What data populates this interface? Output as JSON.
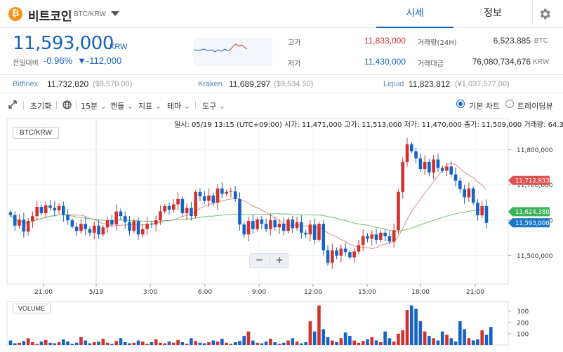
{
  "header": {
    "coin_symbol": "₿",
    "coin_name": "비트코인",
    "pair": "BTC/KRW",
    "tabs": [
      {
        "label": "시세",
        "active": true
      },
      {
        "label": "정보",
        "active": false
      }
    ],
    "settings_icon": "gear-icon"
  },
  "price": {
    "current": "11,593,000",
    "unit": "KRW",
    "prev_label": "전일대비",
    "change_pct": "-0.96%",
    "change_amount": "▼-112,000"
  },
  "stats": {
    "high_label": "고가",
    "high_value": "11,833,000",
    "low_label": "저가",
    "low_value": "11,430,000",
    "volume_label": "거래량(24H)",
    "volume_value": "6,523.885",
    "volume_unit": "BTC",
    "amount_label": "거래대금",
    "amount_value": "76,080,734,676",
    "amount_unit": "KRW"
  },
  "exchanges": [
    {
      "name": "Bitfinex",
      "price": "11,732,820",
      "converted": "($9,570.00)"
    },
    {
      "name": "Kraken",
      "price": "11,689,297",
      "converted": "($9,534.50)"
    },
    {
      "name": "Liquid",
      "price": "11,823,812",
      "converted": "(¥1,037,577.00)"
    }
  ],
  "toolbar": {
    "expand_icon": "expand-icon",
    "reset_label": "초기화",
    "globe_icon": "globe-icon",
    "interval_label": "15분",
    "candle_label": "캔들",
    "indicator_label": "지표",
    "theme_label": "테마",
    "tools_label": "도구",
    "basic_chart_label": "기본 차트",
    "tradingview_label": "트레이딩뷰",
    "selected_view": "기본 차트"
  },
  "chart_info": {
    "text": "일시: 05/19 13:15 (UTC+09:00) 시가: 11,471,000 고가: 11,513,000 저가: 11,470,000 종가: 11,509,000 거래량: 64.364"
  },
  "colors": {
    "up": "#d0312d",
    "down": "#1563c4",
    "ma_red": "#e98b8b",
    "ma_green": "#6cc06c",
    "tag_red": "#e0524f",
    "tag_green": "#3bb25a",
    "tag_blue": "#1b78c8"
  },
  "chart_data": {
    "type": "candlestick",
    "pair_label": "BTC/KRW",
    "x_ticks": [
      "21:00",
      "5/19",
      "3:00",
      "6:00",
      "9:00",
      "12:00",
      "15:00",
      "18:00",
      "21:00"
    ],
    "y_ticks": [
      "11,800,000",
      "11,700,000",
      "11,600,000",
      "11,500,000"
    ],
    "y_tick_values": [
      11800000,
      11700000,
      11600000,
      11500000
    ],
    "ylim": [
      11420000,
      11860000
    ],
    "price_tags": [
      {
        "label": "11,712,933",
        "value": 11712933,
        "color": "red"
      },
      {
        "label": "11,624,380",
        "value": 11624380,
        "color": "green"
      },
      {
        "label": "11,593,000",
        "value": 11593000,
        "color": "blue"
      }
    ],
    "close_series": [
      11615000,
      11585000,
      11602000,
      11568000,
      11598000,
      11612000,
      11638000,
      11620000,
      11642000,
      11635000,
      11628000,
      11640000,
      11615000,
      11600000,
      11582000,
      11570000,
      11590000,
      11575000,
      11565000,
      11585000,
      11560000,
      11580000,
      11600000,
      11588000,
      11625000,
      11612000,
      11595000,
      11570000,
      11598000,
      11560000,
      11575000,
      11590000,
      11588000,
      11600000,
      11625000,
      11640000,
      11630000,
      11645000,
      11660000,
      11620000,
      11635000,
      11612000,
      11680000,
      11668000,
      11655000,
      11670000,
      11650000,
      11690000,
      11675000,
      11680000,
      11682000,
      11660000,
      11588000,
      11560000,
      11598000,
      11575000,
      11602000,
      11590000,
      11575000,
      11600000,
      11580000,
      11590000,
      11570000,
      11602000,
      11578000,
      11595000,
      11565000,
      11560000,
      11588000,
      11545000,
      11590000,
      11515000,
      11480000,
      11515000,
      11500000,
      11520000,
      11510000,
      11495000,
      11512000,
      11530000,
      11555000,
      11548000,
      11560000,
      11545000,
      11565000,
      11555000,
      11540000,
      11572000,
      11680000,
      11765000,
      11815000,
      11795000,
      11775000,
      11745000,
      11765000,
      11735000,
      11772000,
      11748000,
      11740000,
      11752000,
      11730000,
      11712000,
      11688000,
      11665000,
      11690000,
      11650000,
      11614000,
      11640000,
      11593000
    ],
    "volume_series": [
      40,
      15,
      20,
      35,
      60,
      25,
      10,
      30,
      45,
      20,
      15,
      25,
      50,
      30,
      10,
      20,
      70,
      40,
      15,
      25,
      30,
      55,
      20,
      10,
      35,
      60,
      25,
      15,
      20,
      40,
      30,
      10,
      25,
      50,
      20,
      15,
      30,
      20,
      45,
      25,
      10,
      60,
      35,
      20,
      15,
      25,
      40,
      30,
      55,
      20,
      10,
      25,
      35,
      80,
      120,
      40,
      20,
      15,
      30,
      55,
      25,
      10,
      20,
      40,
      60,
      30,
      15,
      25,
      210,
      120,
      350,
      140,
      70,
      40,
      25,
      60,
      110,
      80,
      40,
      20,
      35,
      50,
      70,
      40,
      25,
      120,
      60,
      30,
      100,
      130,
      310,
      350,
      320,
      210,
      120,
      80,
      60,
      40,
      120,
      90,
      60,
      30,
      210,
      140,
      60,
      40,
      50,
      130,
      90,
      160
    ],
    "volume_ticks": [
      "300",
      "200",
      "100"
    ],
    "volume_label": "VOLUME"
  }
}
